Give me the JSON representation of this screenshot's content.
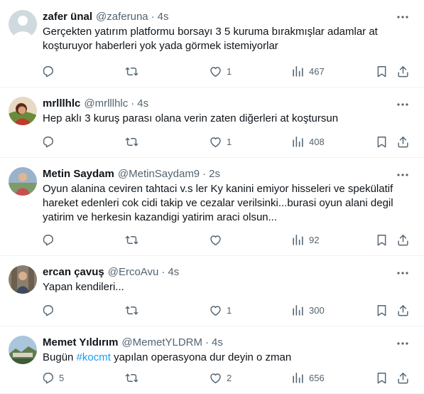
{
  "colors": {
    "text": "#0f1419",
    "secondary": "#536471",
    "link": "#1d9bf0",
    "divider": "#eff3f4"
  },
  "icons": {
    "reply": "reply-icon",
    "retweet": "retweet-icon",
    "like": "heart-icon",
    "views": "views-bar-chart-icon",
    "bookmark": "bookmark-icon",
    "share": "share-icon",
    "more": "more-dots-icon"
  },
  "tweets": [
    {
      "name": "zafer ünal",
      "handle": "@zaferuna",
      "separator": "·",
      "time": "4s",
      "text": "Gerçekten yatırım platformu borsayı 3 5 kuruma bırakmışlar adamlar at koşturuyor haberleri yok yada görmek istemiyorlar",
      "replies": "",
      "retweets": "",
      "likes": "1",
      "views": "467"
    },
    {
      "name": "mrlllhlc",
      "handle": "@mrlllhlc",
      "separator": "·",
      "time": "4s",
      "text": "Hep aklı 3 kuruş parası olana verin zaten diğerleri at koştursun",
      "replies": "",
      "retweets": "",
      "likes": "1",
      "views": "408"
    },
    {
      "name": "Metin Saydam",
      "handle": "@MetinSaydam9",
      "separator": "·",
      "time": "2s",
      "text": "Oyun alanina ceviren tahtaci v.s ler Ky kanini emiyor hisseleri ve spekülatif hareket edenleri cok cidi takip ve cezalar verilsinki...burasi oyun alani degil yatirim ve herkesin kazandigi yatirim araci olsun...",
      "replies": "",
      "retweets": "",
      "likes": "",
      "views": "92"
    },
    {
      "name": "ercan çavuş",
      "handle": "@ErcoAvu",
      "separator": "·",
      "time": "4s",
      "text": "Yapan kendileri...",
      "replies": "",
      "retweets": "",
      "likes": "1",
      "views": "300"
    },
    {
      "name": "Memet Yıldırım",
      "handle": "@MemetYLDRM",
      "separator": "·",
      "time": "4s",
      "text_before": "Bugün ",
      "hashtag": "#kocmt",
      "text_after": " yapılan operasyona dur deyin o zman",
      "replies": "5",
      "retweets": "",
      "likes": "2",
      "views": "656"
    }
  ]
}
